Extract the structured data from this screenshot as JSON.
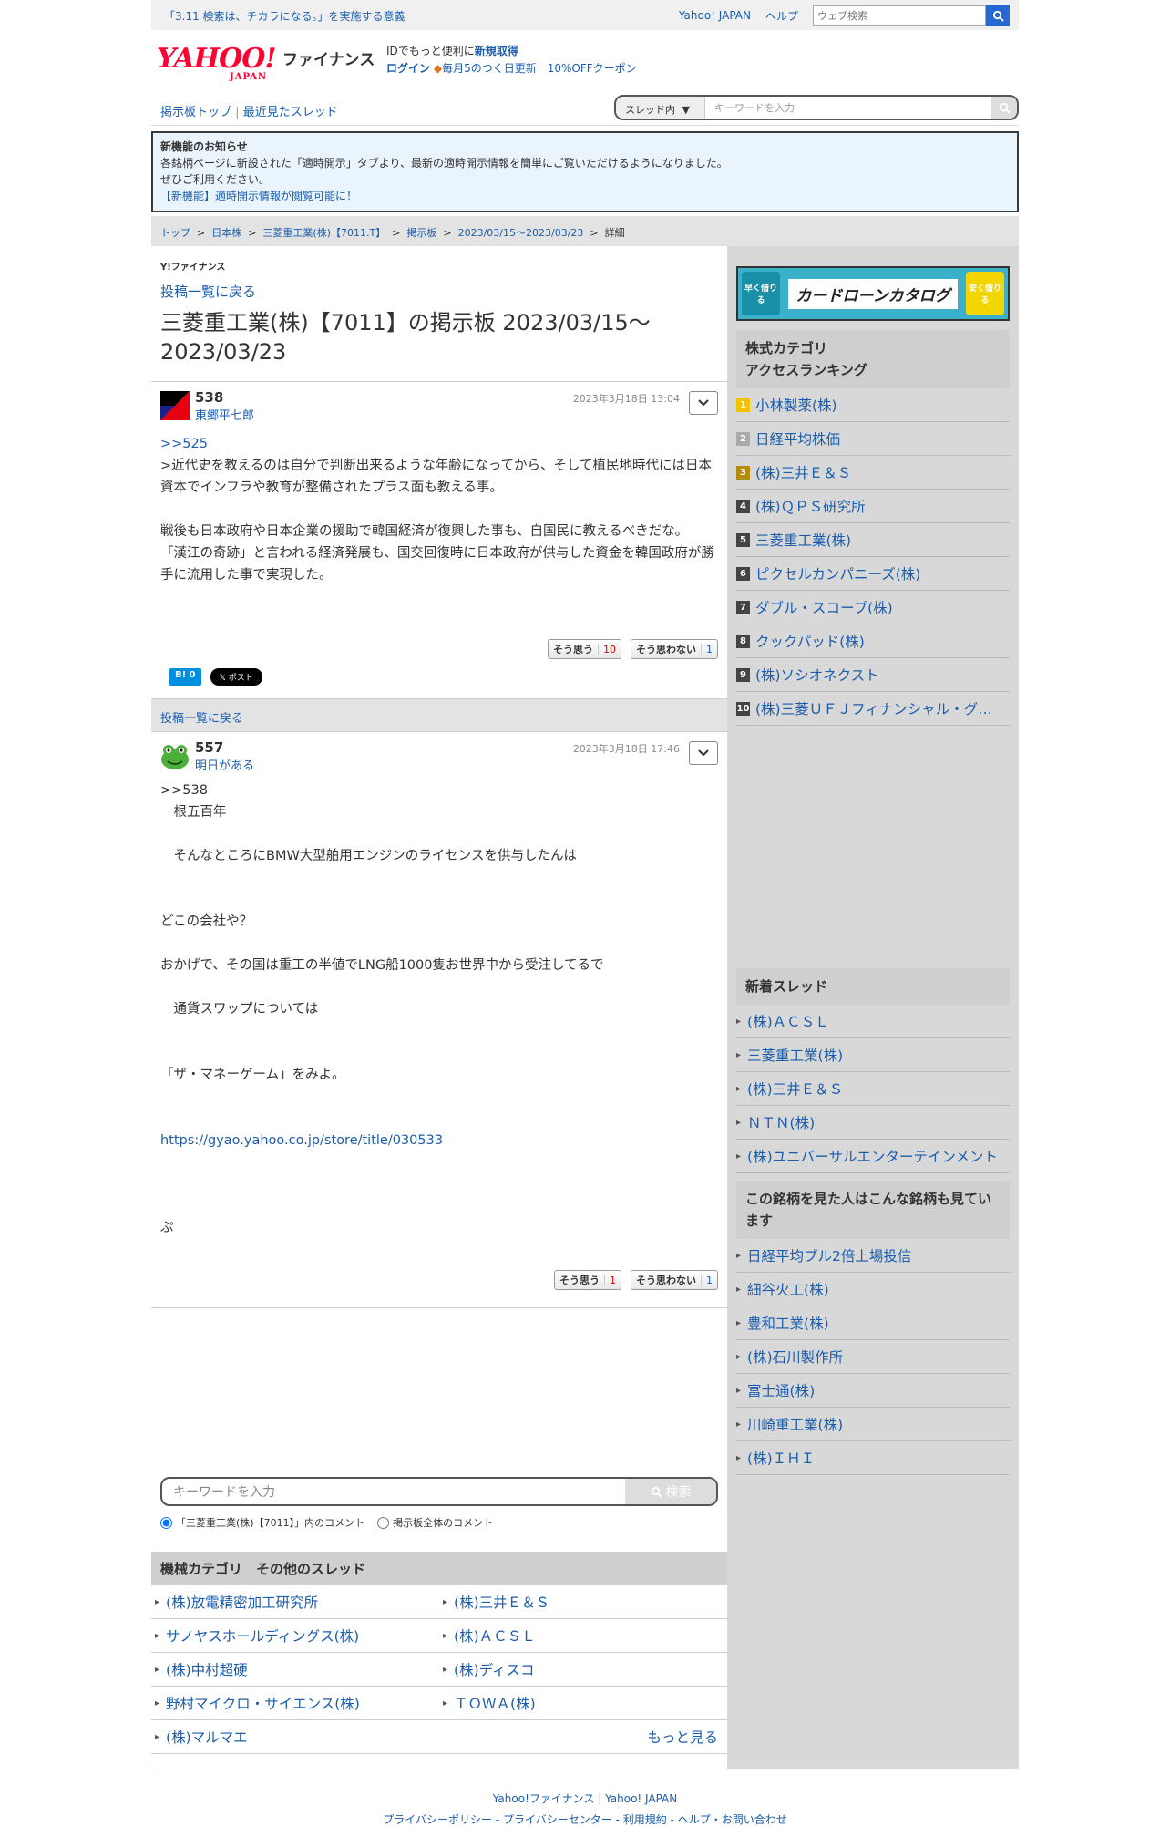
{
  "topbar": {
    "promo": "「3.11 検索は、チカラになる。」を実施する意義",
    "yahoo_japan": "Yahoo! JAPAN",
    "help": "ヘルプ",
    "web_search_placeholder": "ウェブ検索"
  },
  "header": {
    "logo": "YAHOO!",
    "logo_sub": "JAPAN",
    "finance": "ファイナンス",
    "id_text": "IDでもっと便利に",
    "signup": "新規取得",
    "login": "ログイン",
    "promo": "毎月5のつく日更新　10%OFFクーポン"
  },
  "nav": {
    "board_top": "掲示板トップ",
    "recent": "最近見たスレッド",
    "scope": "スレッド内",
    "keyword_placeholder": "キーワードを入力"
  },
  "notice": {
    "title": "新機能のお知らせ",
    "line1": "各銘柄ページに新設された「適時開示」タブより、最新の適時開示情報を簡単にご覧いただけるようになりました。",
    "line2": "ぜひご利用ください。",
    "link": "【新機能】適時開示情報が閲覧可能に！"
  },
  "breadcrumb": {
    "top": "トップ",
    "japan": "日本株",
    "stock": "三菱重工業(株)【7011.T】",
    "board": "掲示板",
    "range": "2023/03/15〜2023/03/23",
    "detail": "詳細"
  },
  "main": {
    "brand": "Y!ファイナンス",
    "back": "投稿一覧に戻る",
    "title": "三菱重工業(株)【7011】の掲示板 2023/03/15〜2023/03/23",
    "back2": "投稿一覧に戻る"
  },
  "post1": {
    "num": "538",
    "user": "東郷平七郎",
    "time": "2023年3月18日 13:04",
    "reply": ">>525",
    "body1": ">近代史を教えるのは自分で判断出来るような年齢になってから、そして植民地時代には日本資本でインフラや教育が整備されたプラス面も教える事。",
    "body2": "戦後も日本政府や日本企業の援助で韓国経済が復興した事も、自国民に教えるべきだな。",
    "body3": "「漢江の奇跡」と言われる経済発展も、国交回復時に日本政府が供与した資金を韓国政府が勝手に流用した事で実現した。",
    "agree": "そう思う",
    "agree_n": "10",
    "disagree": "そう思わない",
    "disagree_n": "1",
    "hatena": "B! 0",
    "tweet": "𝕏 ポスト"
  },
  "post2": {
    "num": "557",
    "user": "明日がある",
    "time": "2023年3月18日 17:46",
    "l1": ">>538",
    "l2": "　根五百年",
    "l3": "　そんなところにBMW大型舶用エンジンのライセンスを供与したんは",
    "l4": "どこの会社や？",
    "l5": "おかげで、その国は重工の半値でLNG船1000隻お世界中から受注してるで",
    "l6": "　通貨スワップについては",
    "l7": "「ザ・マネーゲーム」をみよ。",
    "l8": "https://gyao.yahoo.co.jp/store/title/030533",
    "l9": "ぷ",
    "agree": "そう思う",
    "agree_n": "1",
    "disagree": "そう思わない",
    "disagree_n": "1"
  },
  "bottom_search": {
    "placeholder": "キーワードを入力",
    "button": "検索",
    "opt1": "「三菱重工業(株)【7011】」内のコメント",
    "opt2": "掲示板全体のコメント"
  },
  "other_threads": {
    "title": "機械カテゴリ　その他のスレッド",
    "items": [
      "(株)放電精密加工研究所",
      "(株)三井Ｅ＆Ｓ",
      "サノヤスホールディングス(株)",
      "(株)ＡＣＳＬ",
      "(株)中村超硬",
      "(株)ディスコ",
      "野村マイクロ・サイエンス(株)",
      "ＴＯＷＡ(株)",
      "(株)マルマエ"
    ],
    "more": "もっと見る"
  },
  "side": {
    "ad_text": "カードローンカタログ",
    "ad_left": "早く借りる",
    "ad_right": "安く借りる",
    "ranking_title": "株式カテゴリ\nアクセスランキング",
    "ranking": [
      "小林製薬(株)",
      "日経平均株価",
      "(株)三井Ｅ＆Ｓ",
      "(株)ＱＰＳ研究所",
      "三菱重工業(株)",
      "ピクセルカンパニーズ(株)",
      "ダブル・スコープ(株)",
      "クックパッド(株)",
      "(株)ソシオネクスト",
      "(株)三菱ＵＦＪフィナンシャル・グループ"
    ],
    "new_title": "新着スレッド",
    "new": [
      "(株)ＡＣＳＬ",
      "三菱重工業(株)",
      "(株)三井Ｅ＆Ｓ",
      "ＮＴＮ(株)",
      "(株)ユニバーサルエンターテインメント"
    ],
    "also_title": "この銘柄を見た人はこんな銘柄も見ています",
    "also": [
      "日経平均ブル2倍上場投信",
      "細谷火工(株)",
      "豊和工業(株)",
      "(株)石川製作所",
      "富士通(株)",
      "川崎重工業(株)",
      "(株)ＩＨＩ"
    ]
  },
  "footer": {
    "l1": "Yahoo!ファイナンス",
    "l2": "Yahoo! JAPAN",
    "l3": "プライバシーポリシー - プライバシーセンター - 利用規約 - ヘルプ・お問い合わせ"
  },
  "colors": {
    "link": "#1a5dac",
    "rank1": "#f2c200",
    "rank2": "#aaaaaa",
    "rank3": "#b58b0e",
    "rankN": "#444444"
  }
}
